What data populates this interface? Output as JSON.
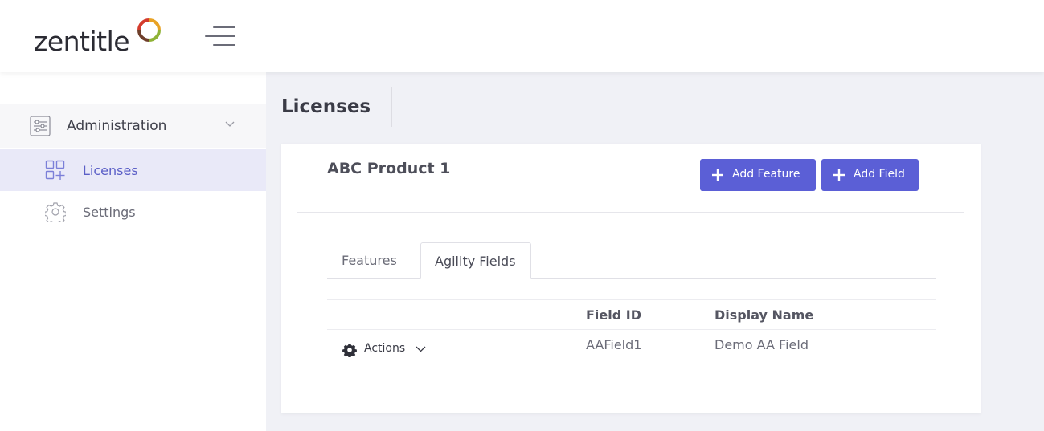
{
  "app": {
    "logo_text": "zentitle",
    "brand_colors": [
      "#d43b2c",
      "#8fb236",
      "#e8a225",
      "#6f3f2b"
    ]
  },
  "header": {
    "menu_icon": "hamburger-icon"
  },
  "sidebar": {
    "group": {
      "label": "Administration",
      "icon": "sliders-icon",
      "expanded": true
    },
    "items": [
      {
        "label": "Licenses",
        "icon": "grid-plus-icon",
        "active": true
      },
      {
        "label": "Settings",
        "icon": "gear-icon",
        "active": false
      }
    ]
  },
  "page": {
    "title": "Licenses"
  },
  "card": {
    "product_name": "ABC Product 1",
    "buttons": {
      "add_feature": "Add Feature",
      "add_field": "Add Field"
    },
    "accent_color": "#5b5fd6",
    "tabs": [
      {
        "label": "Features",
        "active": false
      },
      {
        "label": "Agility Fields",
        "active": true
      }
    ],
    "table": {
      "columns": [
        "",
        "Field ID",
        "Display Name"
      ],
      "rows": [
        {
          "actions_label": "Actions",
          "field_id": "AAField1",
          "display_name": "Demo AA Field"
        }
      ]
    }
  }
}
